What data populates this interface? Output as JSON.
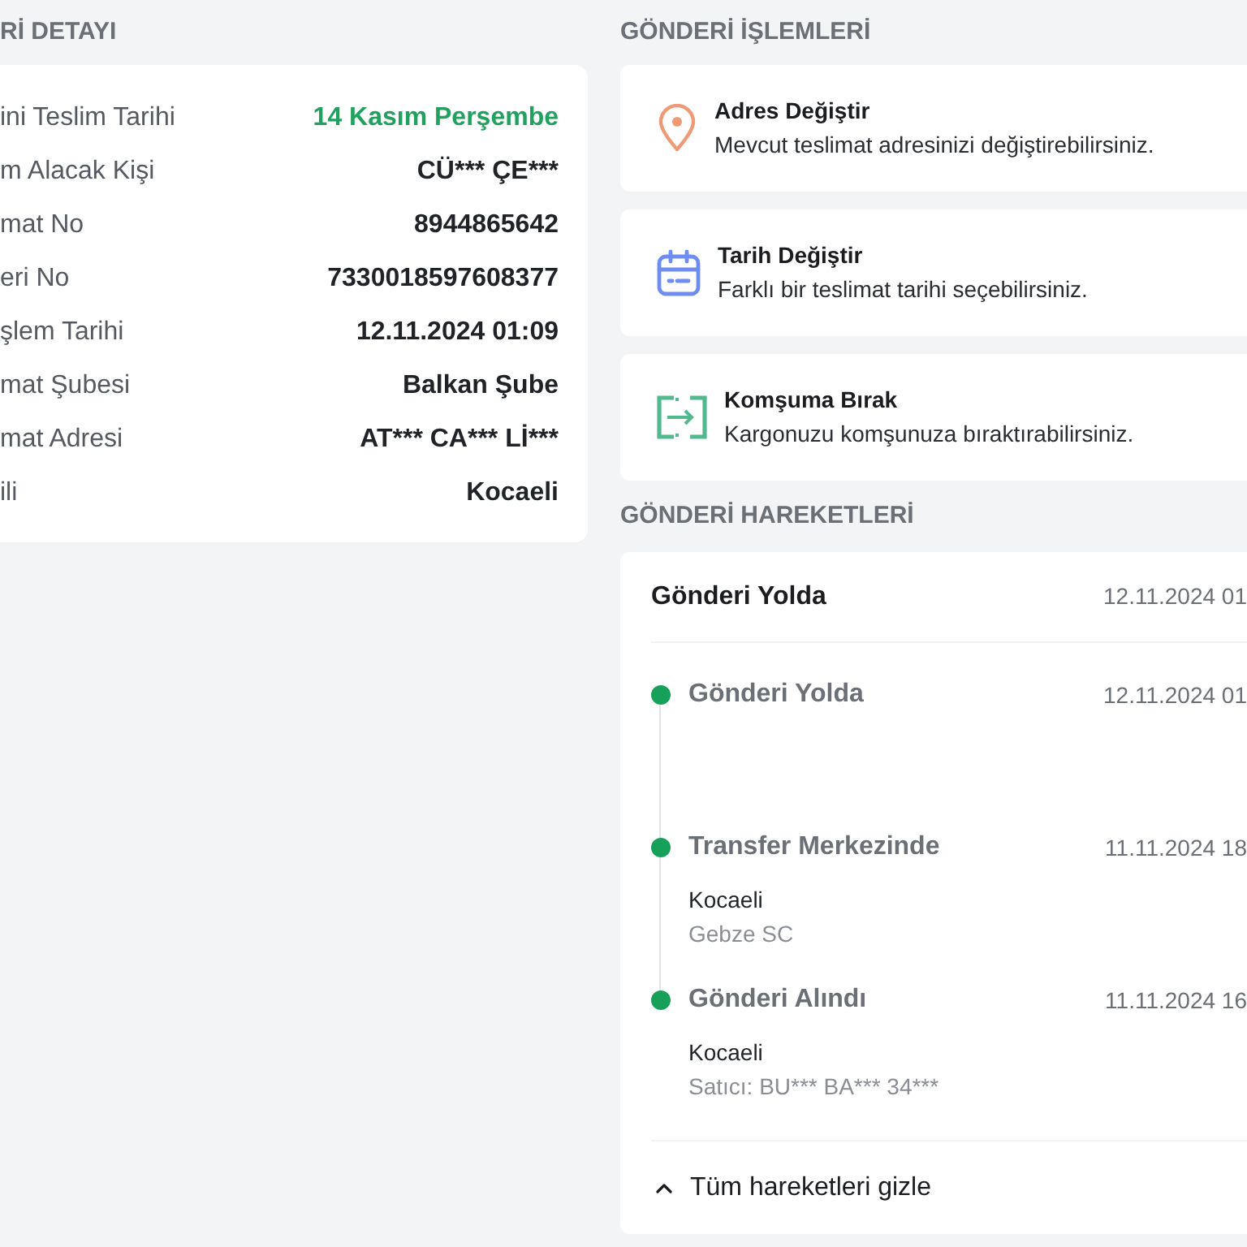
{
  "details": {
    "heading": "Rİ DETAYI",
    "rows": [
      {
        "label": "ini Teslim Tarihi",
        "value": "14 Kasım Perşembe",
        "highlight": true
      },
      {
        "label": "m Alacak Kişi",
        "value": "CÜ*** ÇE***",
        "highlight": false
      },
      {
        "label": "mat No",
        "value": "8944865642",
        "highlight": false
      },
      {
        "label": "eri No",
        "value": "7330018597608377",
        "highlight": false
      },
      {
        "label": "şlem Tarihi",
        "value": "12.11.2024 01:09",
        "highlight": false
      },
      {
        "label": "mat Şubesi",
        "value": "Balkan Şube",
        "highlight": false
      },
      {
        "label": "mat Adresi",
        "value": "AT*** CA*** Lİ***",
        "highlight": false
      },
      {
        "label": "ili",
        "value": "Kocaeli",
        "highlight": false
      }
    ]
  },
  "actions": {
    "heading": "GÖNDERİ İŞLEMLERİ",
    "items": [
      {
        "kind": "address",
        "title": "Adres Değiştir",
        "description": "Mevcut teslimat adresinizi değiştirebilirsiniz."
      },
      {
        "kind": "date",
        "title": "Tarih Değiştir",
        "description": "Farklı bir teslimat tarihi seçebilirsiniz."
      },
      {
        "kind": "neighbor",
        "title": "Komşuma Bırak",
        "description": "Kargonuzu komşunuza bıraktırabilirsiniz."
      }
    ]
  },
  "movements": {
    "heading": "GÖNDERİ HAREKETLERİ",
    "current": {
      "title": "Gönderi Yolda",
      "time": "12.11.2024 01"
    },
    "events": [
      {
        "title": "Gönderi Yolda",
        "time": "12.11.2024 01"
      },
      {
        "title": "Transfer Merkezinde",
        "time": "11.11.2024 18",
        "location": "Kocaeli",
        "detail": "Gebze SC"
      },
      {
        "title": "Gönderi Alındı",
        "time": "11.11.2024 16",
        "location": "Kocaeli",
        "detail": "Satıcı: BU*** BA*** 34***"
      }
    ],
    "toggle": {
      "label": "Tüm hareketleri gizle",
      "expanded": true
    }
  }
}
